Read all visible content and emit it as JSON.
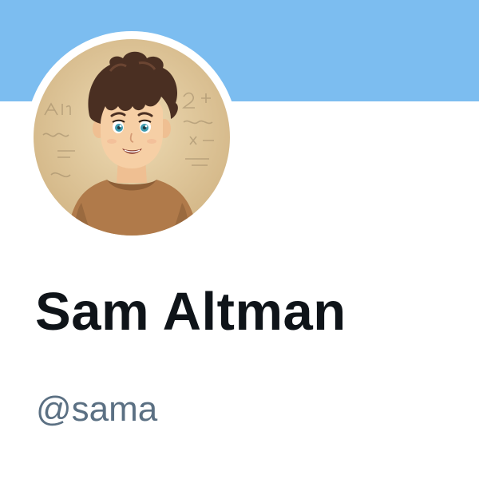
{
  "profile": {
    "display_name": "Sam Altman",
    "handle": "@sama",
    "avatar_icon": "anime-boy-avatar-icon"
  },
  "colors": {
    "banner": "#7cbdf0",
    "background": "#ffffff",
    "name_text": "#0f1419",
    "handle_text": "#5b7083",
    "avatar_background": "#dcc294",
    "shirt": "#b07a4a",
    "hair": "#4a2f22",
    "skin": "#f6cfa5",
    "eyes": "#3f9bb0"
  }
}
